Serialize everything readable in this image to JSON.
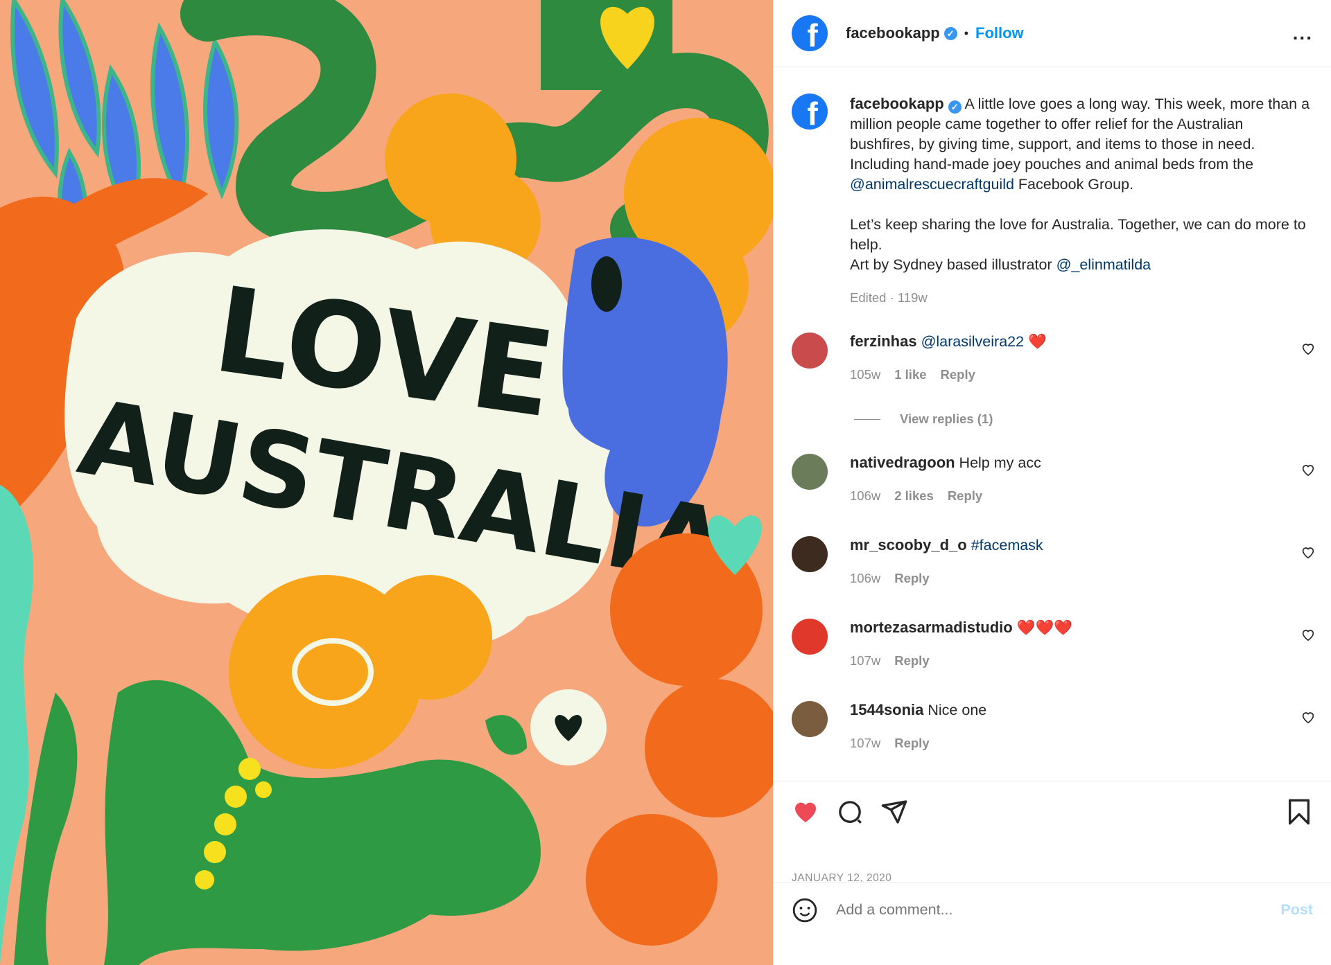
{
  "post": {
    "username": "facebookapp",
    "follow_label": "Follow",
    "separator": "•",
    "more_label": "...",
    "verified_glyph": "✓"
  },
  "caption": {
    "username": "facebookapp",
    "text_1": " A little love goes a long way. This week, more than a million people came together to offer relief for the Australian bushfires, by giving time, support, and items to those in need. Including hand-made joey pouches and animal beds from the ",
    "mention_1": "@animalrescuecraftguild",
    "text_2": " Facebook Group.",
    "text_3": "Let’s keep sharing the love for Australia. Together, we can do more to help.",
    "text_4": "Art by Sydney based illustrator ",
    "mention_2": "@_elinmatilda",
    "meta": "Edited · 119w"
  },
  "comments": [
    {
      "user": "ferzinhas",
      "mention": "@larasilveira22",
      "text": " ❤️",
      "time": "105w",
      "likes": "1 like",
      "reply": "Reply",
      "avatar_color": "#c94b4b"
    },
    {
      "user": "nativedragoon",
      "mention": "",
      "text": " Help my acc",
      "time": "106w",
      "likes": "2 likes",
      "reply": "Reply",
      "avatar_color": "#6b7c5a"
    },
    {
      "user": "mr_scooby_d_o",
      "mention": "#facemask",
      "text": "",
      "time": "106w",
      "likes": "",
      "reply": "Reply",
      "avatar_color": "#3d2b1f"
    },
    {
      "user": "mortezasarmadistudio",
      "mention": "",
      "text": " ❤️❤️❤️",
      "time": "107w",
      "likes": "",
      "reply": "Reply",
      "avatar_color": "#e0392b"
    },
    {
      "user": "1544sonia",
      "mention": "",
      "text": " Nice one",
      "time": "107w",
      "likes": "",
      "reply": "Reply",
      "avatar_color": "#7a5c3e"
    }
  ],
  "view_replies": "View replies (1)",
  "date": "JANUARY 12, 2020",
  "add_comment": {
    "placeholder": "Add a comment...",
    "post_label": "Post"
  },
  "colors": {
    "accent": "#0095f6",
    "like": "#ed4956",
    "fb": "#1877f2"
  }
}
